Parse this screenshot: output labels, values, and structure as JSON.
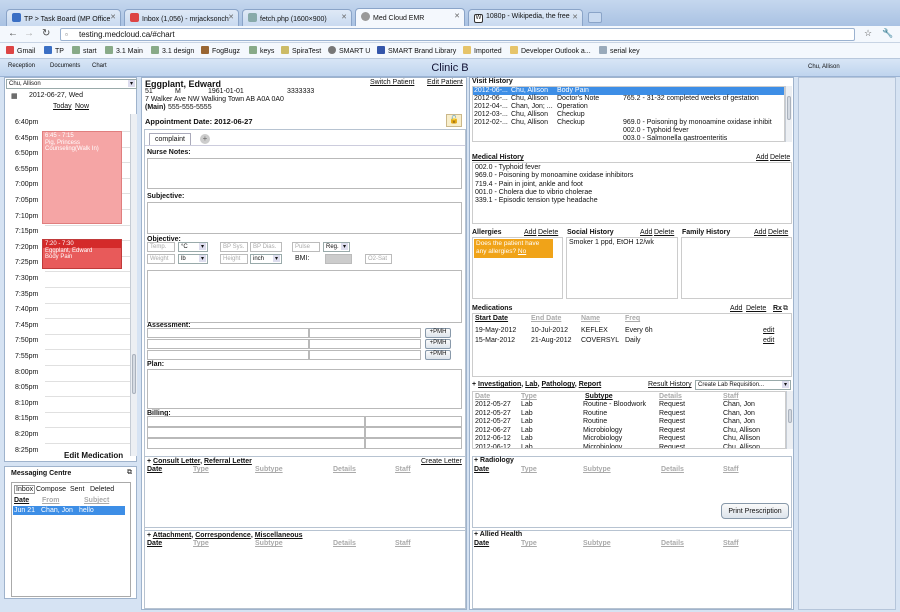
{
  "browser": {
    "tabs": [
      {
        "label": "TP > Task Board (MP Office",
        "color": "#3b6fc4"
      },
      {
        "label": "Inbox (1,056) - mrjacksonch",
        "color": "#d44"
      },
      {
        "label": "fetch.php (1600×900)",
        "color": "#8aa"
      },
      {
        "label": "Med Cloud EMR",
        "color": "#999"
      },
      {
        "label": "1080p - Wikipedia, the free",
        "color": "#333"
      }
    ],
    "url": "testing.medcloud.ca/#chart",
    "bookmarks": [
      "Gmail",
      "TP",
      "start",
      "3.1 Main",
      "3.1 design",
      "FogBugz",
      "keys",
      "SpiraTest",
      "SMART U",
      "SMART Brand Library",
      "Imported",
      "Developer Outlook a...",
      "serial key"
    ]
  },
  "app": {
    "nav": [
      "Reception",
      "Documents",
      "Chart"
    ],
    "clinic": "Clinic B",
    "user": "Chu, Allison"
  },
  "calendar": {
    "provider": "Chu, Allison",
    "date": "2012-06-27, Wed",
    "today": "Today",
    "now": "Now",
    "times": [
      "6:40pm",
      "6:45pm",
      "6:50pm",
      "6:55pm",
      "7:00pm",
      "7:05pm",
      "7:10pm",
      "7:15pm",
      "7:20pm",
      "7:25pm",
      "7:30pm",
      "7:35pm",
      "7:40pm",
      "7:45pm",
      "7:50pm",
      "7:55pm",
      "8:00pm",
      "8:05pm",
      "8:10pm",
      "8:15pm",
      "8:20pm",
      "8:25pm"
    ],
    "appt1": {
      "time": "6:45 - 7:15",
      "line1": "Pig, Princess",
      "line2": "Counseling(Walk In)"
    },
    "appt2": {
      "time": "7:20 - 7:30",
      "line1": "Eggplant, Edward",
      "line2": "Body Pain"
    },
    "edit_med": "Edit Medication"
  },
  "messaging": {
    "title": "Messaging Centre",
    "tabs": [
      "Inbox",
      "Compose",
      "Sent",
      "Deleted"
    ],
    "cols": [
      "Date",
      "From",
      "Subject"
    ],
    "row": {
      "date": "Jun 21",
      "from": "Chan, Jon",
      "subject": "hello"
    }
  },
  "patient": {
    "name": "Eggplant, Edward",
    "age": "51",
    "sex": "M",
    "dob": "1961-01-01",
    "id": "3333333",
    "address": "7 Walker Ave NW Walking Town AB A0A 0A0",
    "phone_label": "(Main)",
    "phone": "555-555-5555",
    "switch": "Switch Patient",
    "edit": "Edit Patient",
    "appt_date": "Appointment Date: 2012-06-27"
  },
  "note": {
    "tab": "complaint",
    "nurse": "Nurse Notes:",
    "subjective": "Subjective:",
    "objective": "Objective:",
    "temp": "Temp.",
    "temp_unit": "°C",
    "bp_sys": "BP Sys.",
    "bp_dias": "BP Dias.",
    "pulse": "Pulse",
    "reg": "Reg.",
    "weight": "Weight",
    "weight_unit": "lb",
    "height": "Height",
    "height_unit": "inch",
    "bmi": "BMI:",
    "o2": "O2-Sat",
    "assessment": "Assessment:",
    "pmh": "+PMH",
    "plan": "Plan:",
    "billing": "Billing:"
  },
  "letters": {
    "title1": "Consult Letter",
    "title2": "Referral Letter",
    "create": "Create Letter",
    "cols": [
      "Date",
      "Type",
      "Subtype",
      "Details",
      "Staff"
    ]
  },
  "attach": {
    "title1": "Attachment",
    "title2": "Correspondence",
    "title3": "Miscellaneous",
    "cols": [
      "Date",
      "Type",
      "Subtype",
      "Details",
      "Staff"
    ]
  },
  "visits": {
    "title": "Visit History",
    "rows": [
      {
        "date": "2012-06-...",
        "staff": "Chu, Allison",
        "type": "Body Pain",
        "detail": ""
      },
      {
        "date": "2012-06-...",
        "staff": "Chu, Allison",
        "type": "Doctor's Note",
        "detail": "765.2 - 31-32 completed weeks of gestation"
      },
      {
        "date": "2012-04-...",
        "staff": "Chan, Jon; ...",
        "type": "Operation",
        "detail": ""
      },
      {
        "date": "2012-03-...",
        "staff": "Chu, Allison",
        "type": "Checkup",
        "detail": ""
      },
      {
        "date": "2012-02-...",
        "staff": "Chu, Allison",
        "type": "Checkup",
        "detail": "969.0 - Poisoning by monoamine oxidase inhibit"
      },
      {
        "date": "",
        "staff": "",
        "type": "",
        "detail": "002.0 - Typhoid fever"
      },
      {
        "date": "",
        "staff": "",
        "type": "",
        "detail": "003.0 - Salmonella gastroenteritis"
      }
    ]
  },
  "medical_history": {
    "title": "Medical History",
    "add": "Add",
    "delete": "Delete",
    "items": [
      "002.0 - Typhoid fever",
      "969.0 - Poisoning by monoamine oxidase inhibitors",
      "719.4 - Pain in joint, ankle and foot",
      "001.0 - Cholera due to vibrio cholerae",
      "339.1 - Episodic tension type headache"
    ]
  },
  "allergies": {
    "title": "Allergies",
    "add": "Add",
    "delete": "Delete",
    "prompt": "Does the patient have any allergies?",
    "no": "No"
  },
  "social": {
    "title": "Social History",
    "add": "Add",
    "delete": "Delete",
    "text": "Smoker 1 ppd, EtOH 12/wk"
  },
  "family": {
    "title": "Family History",
    "add": "Add",
    "delete": "Delete"
  },
  "medications": {
    "title": "Medications",
    "add": "Add",
    "delete": "Delete",
    "rx": "Rx",
    "cols": [
      "Start Date",
      "End Date",
      "Name",
      "Freq"
    ],
    "rows": [
      {
        "start": "19-May-2012",
        "end": "10-Jul-2012",
        "name": "KEFLEX",
        "freq": "Every 6h",
        "edit": "edit"
      },
      {
        "start": "15-Mar-2012",
        "end": "21-Aug-2012",
        "name": "COVERSYL",
        "freq": "Daily",
        "edit": "edit"
      }
    ]
  },
  "investigation": {
    "t1": "Investigation",
    "t2": "Lab",
    "t3": "Pathology",
    "t4": "Report",
    "result_history": "Result History",
    "create": "Create Lab Requisition...",
    "cols": [
      "Date",
      "Type",
      "Subtype",
      "Details",
      "Staff"
    ],
    "rows": [
      {
        "date": "2012-05-27",
        "type": "Lab",
        "subtype": "Routine - Bloodwork",
        "details": "Request",
        "staff": "Chan, Jon"
      },
      {
        "date": "2012-05-27",
        "type": "Lab",
        "subtype": "Routine",
        "details": "Request",
        "staff": "Chan, Jon"
      },
      {
        "date": "2012-05-27",
        "type": "Lab",
        "subtype": "Routine",
        "details": "Request",
        "staff": "Chan, Jon"
      },
      {
        "date": "2012-06-27",
        "type": "Lab",
        "subtype": "Microbiology",
        "details": "Request",
        "staff": "Chu, Allison"
      },
      {
        "date": "2012-06-12",
        "type": "Lab",
        "subtype": "Microbiology",
        "details": "Request",
        "staff": "Chu, Allison"
      },
      {
        "date": "2012-06-12",
        "type": "Lab",
        "subtype": "Microbiology",
        "details": "Request",
        "staff": "Chu, Allison"
      }
    ]
  },
  "radiology": {
    "title": "Radiology",
    "cols": [
      "Date",
      "Type",
      "Subtype",
      "Details",
      "Staff"
    ],
    "print": "Print Prescription"
  },
  "allied": {
    "title": "Allied Health",
    "cols": [
      "Date",
      "Type",
      "Subtype",
      "Details",
      "Staff"
    ]
  }
}
